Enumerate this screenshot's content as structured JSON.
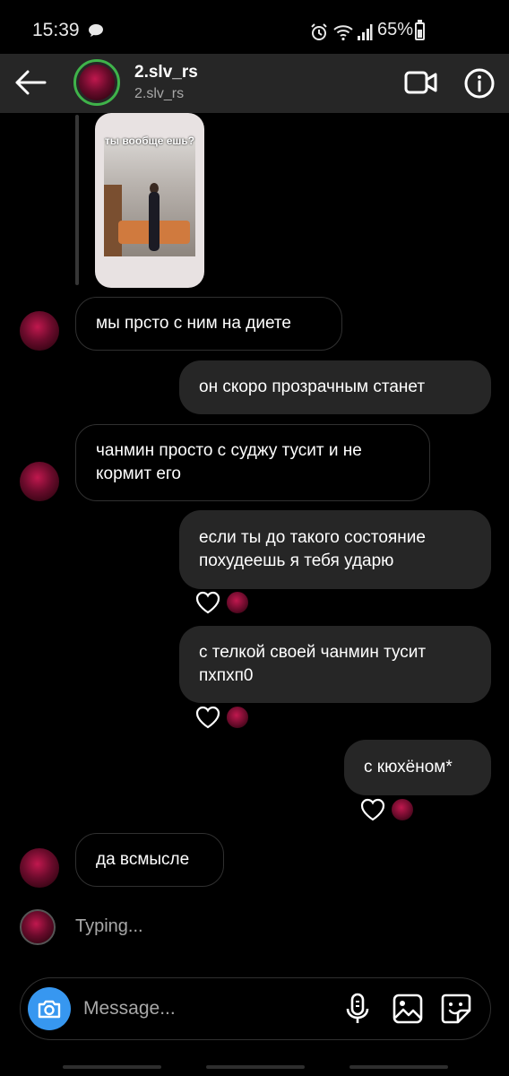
{
  "status_bar": {
    "time": "15:39",
    "battery": "65%"
  },
  "header": {
    "name": "2.slv_rs",
    "username": "2.slv_rs",
    "online_ring_color": "#3fb34a"
  },
  "story": {
    "caption": "ты вообще ешь?"
  },
  "messages": [
    {
      "side": "in",
      "text": "мы прсто с ним на диете"
    },
    {
      "side": "out",
      "text": "он скоро прозрачным станет"
    },
    {
      "side": "in",
      "line1": "чанмин просто с суджу тусит и не",
      "line2": "кормит его"
    },
    {
      "side": "out",
      "line1": "если ты до такого состояние",
      "line2": "похудеешь я тебя ударю",
      "reaction": "heart"
    },
    {
      "side": "out",
      "line1": "с телкой своей чанмин тусит",
      "line2": "пхпхп0",
      "reaction": "heart"
    },
    {
      "side": "out",
      "text": "с кюхёном*",
      "reaction": "heart"
    },
    {
      "side": "in",
      "text": "да всмысле"
    }
  ],
  "typing": "Typing...",
  "composer": {
    "placeholder": "Message...",
    "accent": "#3797f0"
  },
  "colors": {
    "background": "#000000",
    "header_bg": "#262626",
    "outgoing_bubble": "#262626"
  }
}
